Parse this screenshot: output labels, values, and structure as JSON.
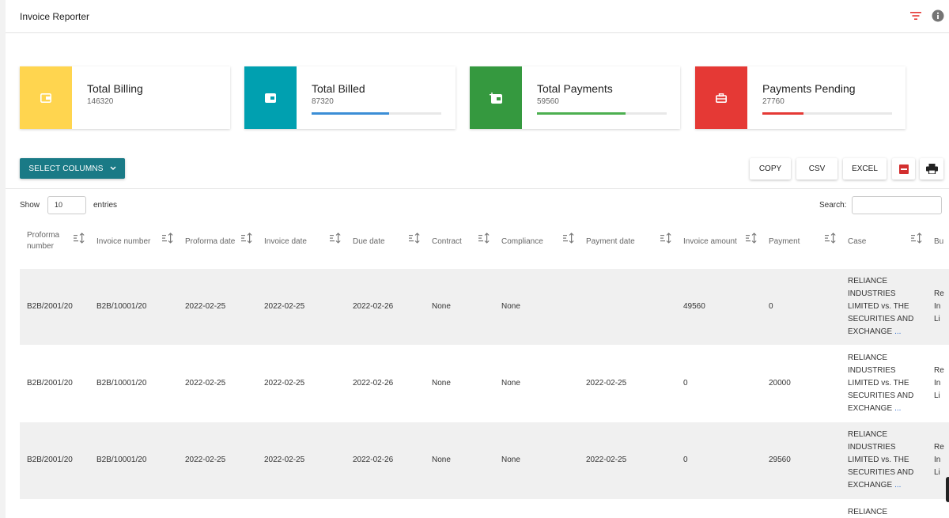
{
  "header": {
    "title": "Invoice Reporter",
    "filter_icon": "filter-icon",
    "info_icon": "info-icon"
  },
  "colors": {
    "yellow": "#FFD54F",
    "teal": "#00A0B0",
    "green": "#35993F",
    "red": "#E53935",
    "blue_bar": "#3B8ED6",
    "green_bar": "#4CAF50",
    "red_bar": "#E53935",
    "button": "#1A7A86"
  },
  "cards": [
    {
      "title": "Total Billing",
      "value": "146320",
      "icon": "wallet-icon"
    },
    {
      "title": "Total Billed",
      "value": "87320",
      "icon": "wallet-icon",
      "progress": 0.6
    },
    {
      "title": "Total Payments",
      "value": "59560",
      "icon": "wallet-add-icon",
      "progress": 0.68
    },
    {
      "title": "Payments Pending",
      "value": "27760",
      "icon": "briefcase-icon",
      "progress": 0.32
    }
  ],
  "toolbar": {
    "select_columns": "SELECT COLUMNS",
    "copy": "COPY",
    "csv": "CSV",
    "excel": "EXCEL",
    "pdf_icon": "pdf-icon",
    "print_icon": "print-icon"
  },
  "table_controls": {
    "show": "Show",
    "entries_value": "10",
    "entries": "entries",
    "search": "Search:"
  },
  "columns": [
    "Proforma number",
    "Invoice number",
    "Proforma date",
    "Invoice date",
    "Due date",
    "Contract",
    "Compliance",
    "Payment date",
    "Invoice amount",
    "Payment",
    "Case",
    "Bu"
  ],
  "rows": [
    {
      "proforma": "B2B/2001/20",
      "invoice": "B2B/10001/20",
      "proforma_date": "2022-02-25",
      "invoice_date": "2022-02-25",
      "due_date": "2022-02-26",
      "contract": "None",
      "compliance": "None",
      "payment_date": "",
      "amount": "49560",
      "payment": "0",
      "case": [
        "RELIANCE",
        "INDUSTRIES",
        "LIMITED vs. THE",
        "SECURITIES AND",
        "EXCHANGE"
      ],
      "more": "...",
      "bu": [
        "Re",
        "In",
        "Li"
      ]
    },
    {
      "proforma": "B2B/2001/20",
      "invoice": "B2B/10001/20",
      "proforma_date": "2022-02-25",
      "invoice_date": "2022-02-25",
      "due_date": "2022-02-26",
      "contract": "None",
      "compliance": "None",
      "payment_date": "2022-02-25",
      "amount": "0",
      "payment": "20000",
      "case": [
        "RELIANCE",
        "INDUSTRIES",
        "LIMITED vs. THE",
        "SECURITIES AND",
        "EXCHANGE"
      ],
      "more": "...",
      "bu": [
        "Re",
        "In",
        "Li"
      ]
    },
    {
      "proforma": "B2B/2001/20",
      "invoice": "B2B/10001/20",
      "proforma_date": "2022-02-25",
      "invoice_date": "2022-02-25",
      "due_date": "2022-02-26",
      "contract": "None",
      "compliance": "None",
      "payment_date": "2022-02-25",
      "amount": "0",
      "payment": "29560",
      "case": [
        "RELIANCE",
        "INDUSTRIES",
        "LIMITED vs. THE",
        "SECURITIES AND",
        "EXCHANGE"
      ],
      "more": "...",
      "bu": [
        "Re",
        "In",
        "Li"
      ]
    },
    {
      "case": [
        "RELIANCE"
      ]
    }
  ]
}
